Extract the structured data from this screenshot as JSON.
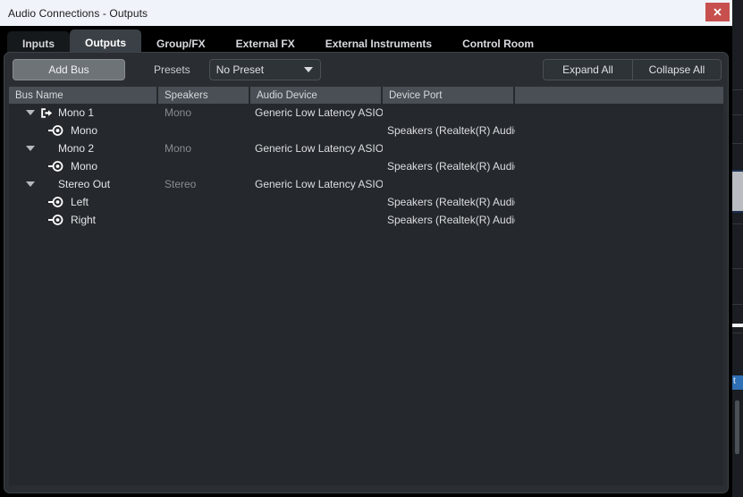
{
  "window": {
    "title": "Audio Connections - Outputs",
    "close_label": "Close",
    "close_icon": "close-icon"
  },
  "tabs": [
    {
      "label": "Inputs",
      "active": false
    },
    {
      "label": "Outputs",
      "active": true
    },
    {
      "label": "Group/FX",
      "active": false
    },
    {
      "label": "External FX",
      "active": false
    },
    {
      "label": "External Instruments",
      "active": false
    },
    {
      "label": "Control Room",
      "active": false
    }
  ],
  "toolbar": {
    "add_bus_label": "Add Bus",
    "presets_label": "Presets",
    "preset_value": "No Preset",
    "preset_caret_icon": "chevron-down-icon",
    "expand_all_label": "Expand All",
    "collapse_all_label": "Collapse All"
  },
  "table": {
    "columns": [
      "Bus Name",
      "Speakers",
      "Audio Device",
      "Device Port",
      ""
    ],
    "rows": [
      {
        "type": "bus",
        "expanded": true,
        "twisty_icon": "triangle-down-icon",
        "bus_icon": "output-bus-icon",
        "name": "Mono 1",
        "speakers": "Mono",
        "audio_device": "Generic Low Latency ASIO D",
        "device_port": ""
      },
      {
        "type": "channel",
        "port_icon": "audio-port-icon",
        "name": "Mono",
        "speakers": "",
        "audio_device": "",
        "device_port": "Speakers (Realtek(R) Audio)"
      },
      {
        "type": "bus",
        "expanded": true,
        "twisty_icon": "triangle-down-icon",
        "bus_icon": "",
        "name": "Mono 2",
        "speakers": "Mono",
        "audio_device": "Generic Low Latency ASIO D",
        "device_port": ""
      },
      {
        "type": "channel",
        "port_icon": "audio-port-icon",
        "name": "Mono",
        "speakers": "",
        "audio_device": "",
        "device_port": "Speakers (Realtek(R) Audio)"
      },
      {
        "type": "bus",
        "expanded": true,
        "twisty_icon": "triangle-down-icon",
        "bus_icon": "",
        "name": "Stereo Out",
        "speakers": "Stereo",
        "audio_device": "Generic Low Latency ASIO D",
        "device_port": ""
      },
      {
        "type": "channel",
        "port_icon": "audio-port-icon",
        "name": "Left",
        "speakers": "",
        "audio_device": "",
        "device_port": "Speakers (Realtek(R) Audio)"
      },
      {
        "type": "channel",
        "port_icon": "audio-port-icon",
        "name": "Right",
        "speakers": "",
        "audio_device": "",
        "device_port": "Speakers (Realtek(R) Audio)"
      }
    ]
  },
  "background": {
    "taskbar_fragment": "t"
  },
  "colors": {
    "titlebar_bg": "#f0f3f9",
    "close_btn": "#c7504f",
    "tabstrip_bg": "#000000",
    "active_tab_bg": "#3a4045",
    "dialog_bg": "#2a2e32",
    "table_bg": "#25292d",
    "header_bg": "#494f54",
    "add_bus_bg": "#6e7378",
    "text_primary": "#e3e5e8",
    "text_dim": "#878c91"
  }
}
